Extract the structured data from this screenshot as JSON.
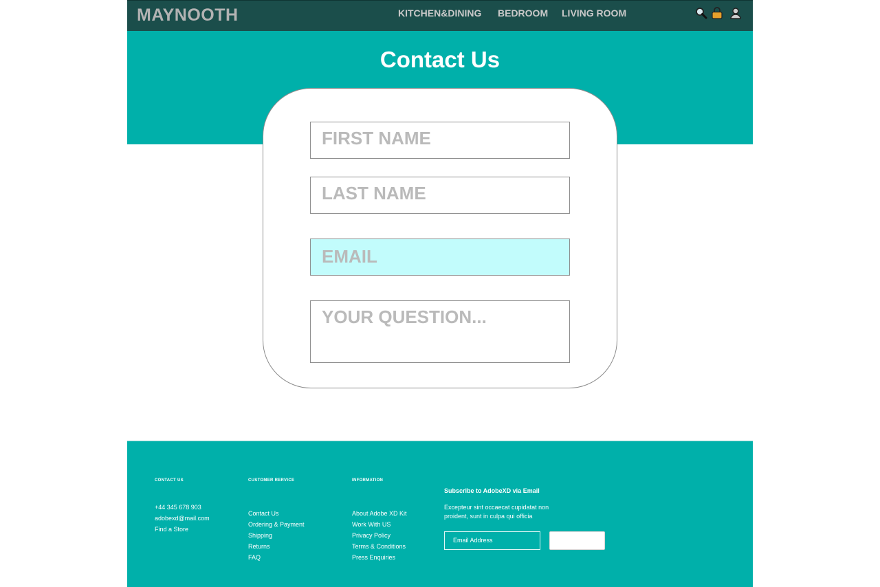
{
  "header": {
    "brand": "MAYNOOTH",
    "nav": [
      "KITCHEN&DINING",
      "BEDROOM",
      "LIVING ROOM"
    ],
    "icons": [
      "search-icon",
      "bag-icon",
      "user-icon"
    ]
  },
  "hero": {
    "title": "Contact Us"
  },
  "form": {
    "first_name_placeholder": "FIRST NAME",
    "last_name_placeholder": "LAST NAME",
    "email_placeholder": "EMAIL",
    "question_placeholder": "YOUR QUESTION..."
  },
  "footer": {
    "contact": {
      "heading": "CONTACT US",
      "items": [
        "+44 345 678 903",
        "adobexd@mail.com",
        "Find a Store"
      ]
    },
    "customer_service": {
      "heading": "CUSTOMER RERVICE",
      "items": [
        "Contact Us",
        "Ordering & Payment",
        "Shipping",
        "Returns",
        "FAQ"
      ]
    },
    "information": {
      "heading": "INFORMATION",
      "items": [
        "About Adobe XD Kit",
        "Work With US",
        "Privacy Policy",
        "Terms & Conditions",
        "Press Enquiries"
      ]
    },
    "subscribe": {
      "heading": "Subscribe to AdobeXD via Email",
      "text": "Excepteur sint occaecat cupidatat non proident, sunt in culpa qui officia",
      "email_placeholder": "Email Address",
      "button_label": ""
    }
  },
  "colors": {
    "header_bg": "#1b4e4b",
    "teal": "#00b0aa",
    "email_field_bg": "#c2fcfc"
  }
}
